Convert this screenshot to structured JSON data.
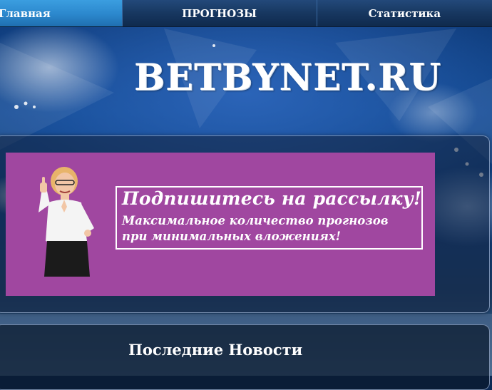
{
  "nav": {
    "items": [
      {
        "label": "Главная",
        "active": true
      },
      {
        "label": "ПРОГНОЗЫ",
        "active": false
      },
      {
        "label": "Статистика",
        "active": false
      }
    ]
  },
  "header": {
    "logo_text": "BETBYNET.RU"
  },
  "banner": {
    "title": "Подпишитесь на рассылку!",
    "line1": "Максимальное количество прогнозов",
    "line2": "при минимальных вложениях!",
    "color": "#a047a0"
  },
  "news": {
    "title": "Последние Новости"
  },
  "colors": {
    "nav_active": "#2b87cc",
    "nav_bg": "#173760",
    "banner_bg": "#a047a0"
  }
}
